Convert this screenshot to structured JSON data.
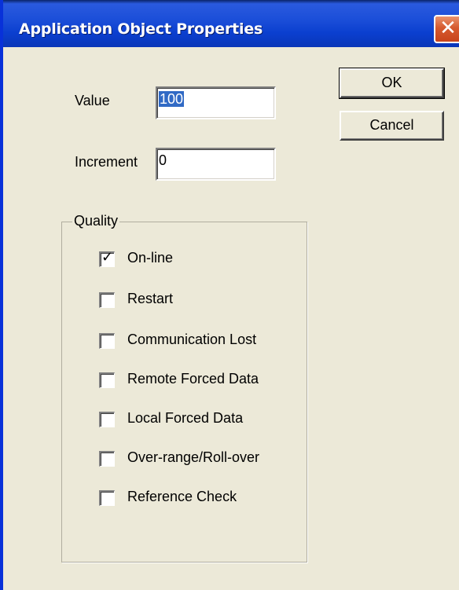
{
  "dialog": {
    "title": "Application Object Properties",
    "close_glyph": "✕",
    "value_label": "Value",
    "value_input": "100",
    "increment_label": "Increment",
    "increment_input": "0",
    "ok_label": "OK",
    "cancel_label": "Cancel",
    "quality": {
      "label": "Quality",
      "items": [
        {
          "label": "On-line",
          "checked": true
        },
        {
          "label": "Restart",
          "checked": false
        },
        {
          "label": "Communication Lost",
          "checked": false
        },
        {
          "label": "Remote Forced Data",
          "checked": false
        },
        {
          "label": "Local Forced Data",
          "checked": false
        },
        {
          "label": "Over-range/Roll-over",
          "checked": false
        },
        {
          "label": "Reference Check",
          "checked": false
        }
      ]
    }
  }
}
